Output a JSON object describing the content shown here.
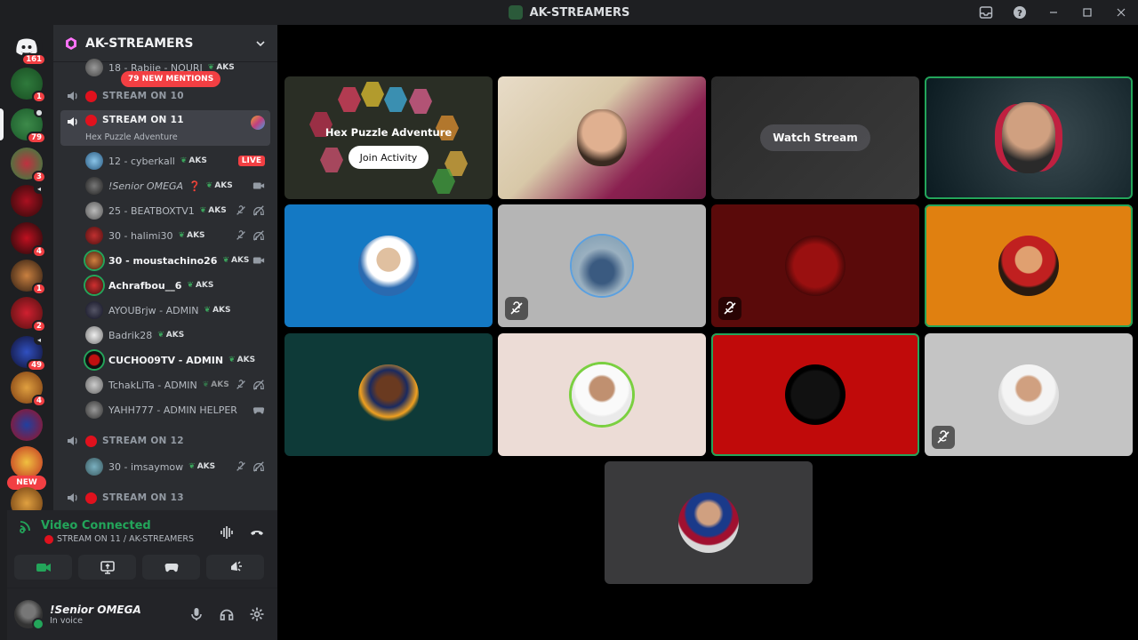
{
  "window": {
    "title": "AK-STREAMERS",
    "controls": [
      "inbox-icon",
      "help-icon",
      "minimize-icon",
      "maximize-icon",
      "close-icon"
    ]
  },
  "colors": {
    "background": "#000000",
    "sidebar": "#2b2d31",
    "rail": "#1e1f22",
    "accent_green": "#23a55a",
    "accent_red": "#f23f43"
  },
  "rail": {
    "home_badge": "161",
    "servers": [
      {
        "badge": "1"
      },
      {
        "badge": "79"
      },
      {
        "badge": "3"
      },
      {
        "badge": ""
      },
      {
        "badge": "4"
      },
      {
        "badge": "1"
      },
      {
        "badge": "2"
      },
      {
        "badge": "49"
      },
      {
        "badge": "4"
      },
      {
        "badge": ""
      },
      {
        "badge": ""
      },
      {
        "badge": "18"
      }
    ],
    "new_label": "NEW"
  },
  "sidebar": {
    "guild_name": "AK-STREAMERS",
    "new_mentions": "79 NEW MENTIONS",
    "partial_member": "18 - Rabiie - NOURI",
    "channels": {
      "c10": "STREAM ON 10",
      "c11": "STREAM ON 11",
      "c11_activity": "Hex Puzzle Adventure",
      "c12": "STREAM ON 12",
      "c13": "STREAM ON 13"
    },
    "tag": "AKS",
    "live_label": "LIVE",
    "members": [
      {
        "name": "12 - cyberkall"
      },
      {
        "name": "!Senior OMEGA"
      },
      {
        "name": "25 - BEATBOXTV1"
      },
      {
        "name": "30 - halimi30"
      },
      {
        "name": "30 - moustachino26"
      },
      {
        "name": "Achrafbou__6"
      },
      {
        "name": "AYOUBrjw - ADMIN"
      },
      {
        "name": "Badrik28"
      },
      {
        "name": "CUCHO09TV - ADMIN"
      },
      {
        "name": "TchakLiTa - ADMIN"
      },
      {
        "name": "YAHH777 - ADMIN HELPER"
      }
    ],
    "member_c12": "30 - imsaymow"
  },
  "voice_panel": {
    "title": "Video Connected",
    "subtitle": "STREAM ON 11 / AK-STREAMERS"
  },
  "user_panel": {
    "name": "!Senior OMEGA",
    "status": "In voice"
  },
  "stage": {
    "activity_title": "Hex Puzzle Adventure",
    "join_label": "Join Activity",
    "watch_label": "Watch Stream"
  }
}
